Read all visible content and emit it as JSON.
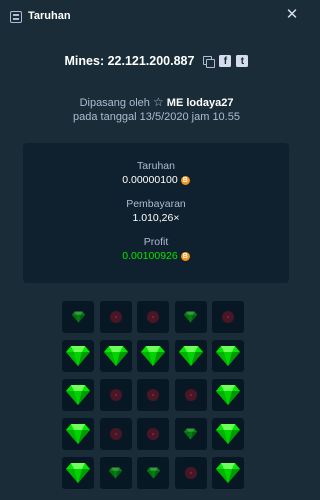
{
  "header": {
    "title": "Taruhan"
  },
  "bet": {
    "label": "Mines: 22.121.200.887"
  },
  "placed": {
    "prefix": "Dipasang oleh",
    "user": "ME lodaya27",
    "date_line": "pada tanggal 13/5/2020 jam 10.55"
  },
  "stats": {
    "bet_label": "Taruhan",
    "bet_value": "0.00000100",
    "payout_label": "Pembayaran",
    "payout_value": "1.010,26×",
    "profit_label": "Profit",
    "profit_value": "0.00100926"
  },
  "currency_symbol": "B",
  "colors": {
    "profit": "#00e701",
    "coin": "#f7931a",
    "gem": "#00e701",
    "mine": "#4a1626"
  },
  "grid": [
    [
      "gem-small",
      "mine-small",
      "mine-small",
      "gem-small",
      "mine-small"
    ],
    [
      "gem-big",
      "gem-big",
      "gem-big",
      "gem-big",
      "gem-big"
    ],
    [
      "gem-big",
      "mine-small",
      "mine-small",
      "mine-small",
      "gem-big"
    ],
    [
      "gem-big",
      "mine-small",
      "mine-small",
      "gem-small",
      "gem-big"
    ],
    [
      "gem-big",
      "gem-small",
      "gem-small",
      "mine-small",
      "gem-big"
    ]
  ]
}
